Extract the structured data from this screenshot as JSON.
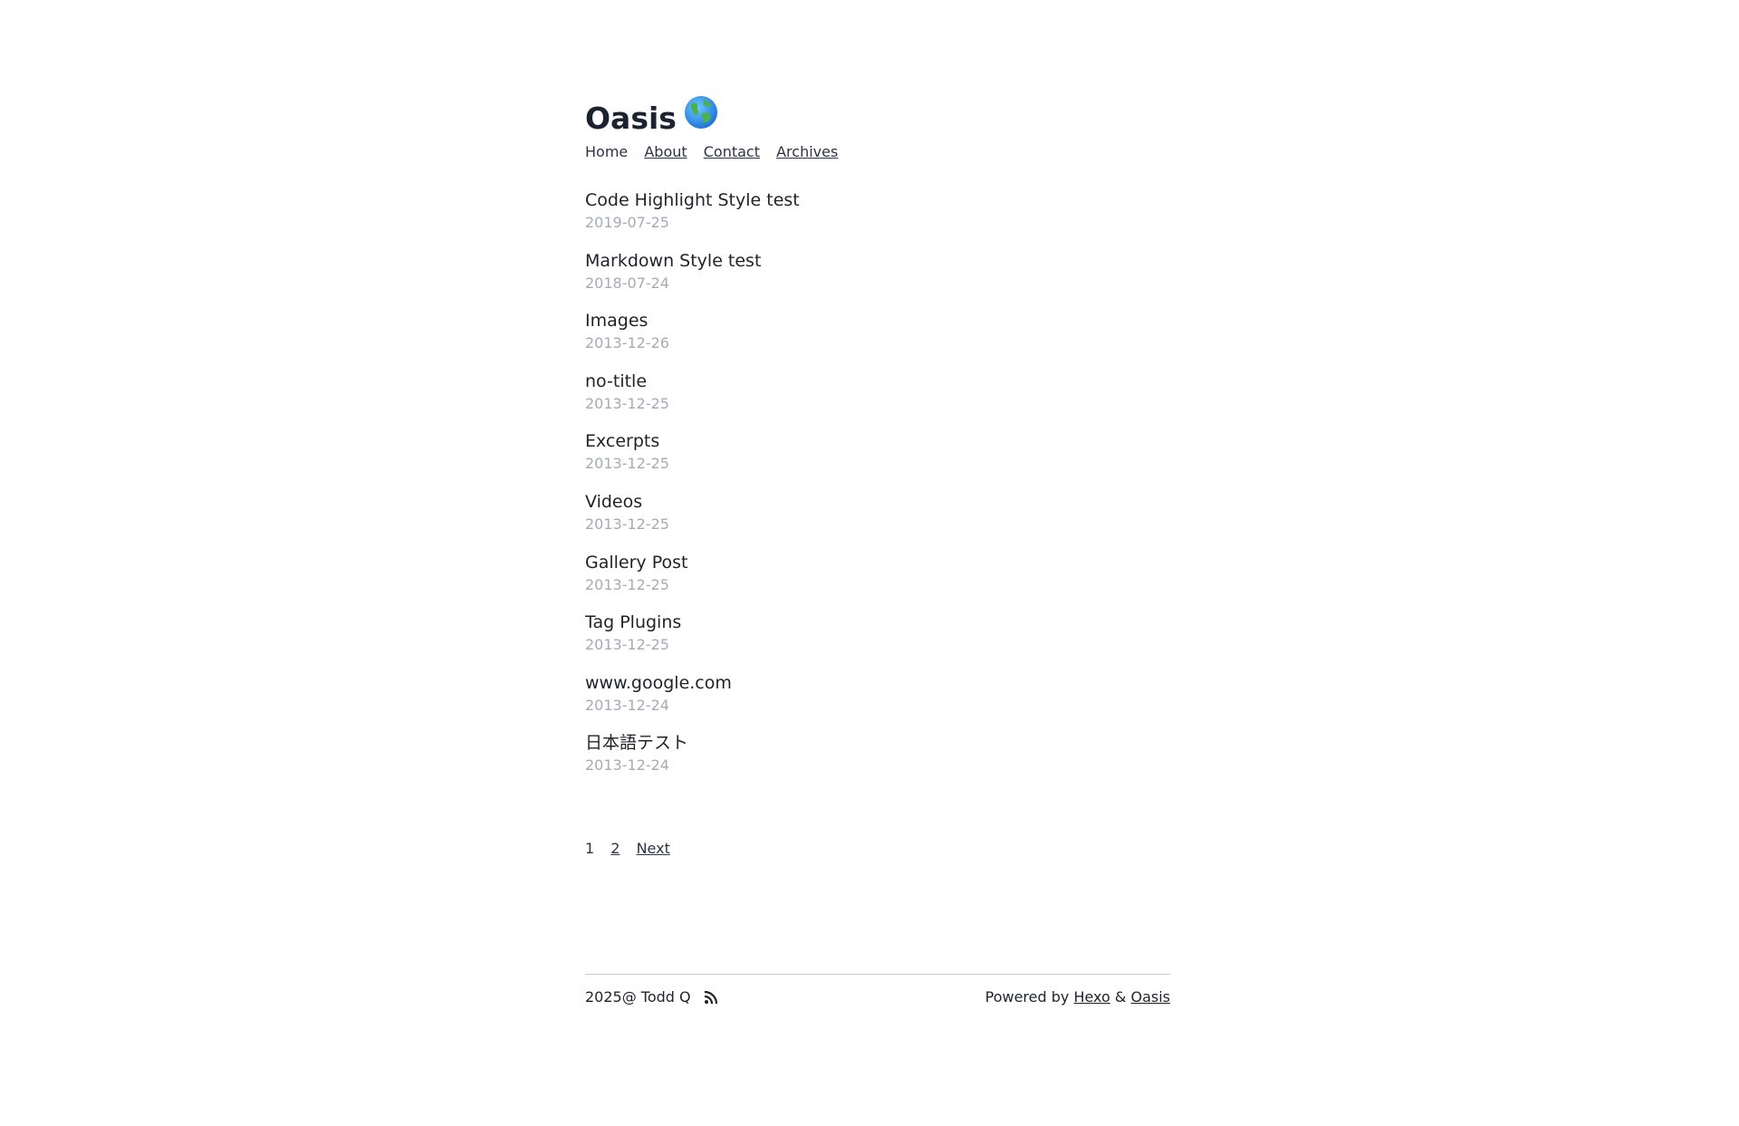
{
  "header": {
    "title": "Oasis",
    "title_icon": "globe-icon"
  },
  "nav": {
    "home": "Home",
    "about": "About",
    "contact": "Contact",
    "archives": "Archives"
  },
  "posts": [
    {
      "title": "Code Highlight Style test",
      "date": "2019-07-25"
    },
    {
      "title": "Markdown Style test",
      "date": "2018-07-24"
    },
    {
      "title": "Images",
      "date": "2013-12-26"
    },
    {
      "title": "no-title",
      "date": "2013-12-25"
    },
    {
      "title": "Excerpts",
      "date": "2013-12-25"
    },
    {
      "title": "Videos",
      "date": "2013-12-25"
    },
    {
      "title": "Gallery Post",
      "date": "2013-12-25"
    },
    {
      "title": "Tag Plugins",
      "date": "2013-12-25"
    },
    {
      "title": "www.google.com",
      "date": "2013-12-24"
    },
    {
      "title": "日本語テスト",
      "date": "2013-12-24"
    }
  ],
  "pagination": {
    "current": "1",
    "page2": "2",
    "next": "Next"
  },
  "footer": {
    "copyright": "2025@ Todd Q",
    "rss_icon": "rss-icon",
    "powered_by": "Powered by",
    "hexo": "Hexo",
    "amp": "&",
    "oasis": "Oasis"
  },
  "colors": {
    "title": "#1b2230",
    "text": "#1f2328",
    "date": "#a6abb3",
    "divider": "#c9ccd1"
  }
}
